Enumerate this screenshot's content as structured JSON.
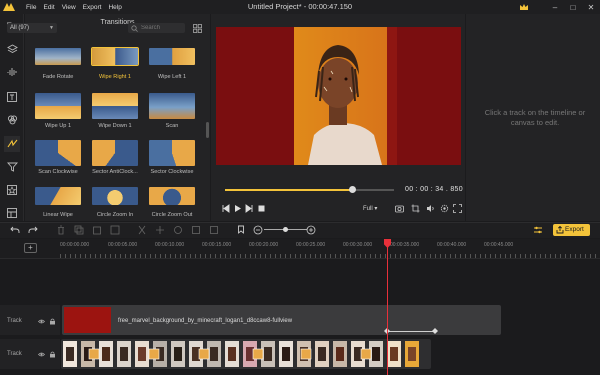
{
  "app": {
    "title": "Untitled Project* - 00:00:47.150",
    "menu": [
      "File",
      "Edit",
      "View",
      "Export",
      "Help"
    ]
  },
  "panel": {
    "title": "Transitions",
    "filter": "All (97)",
    "search_placeholder": "Search",
    "items": [
      {
        "label": "Fade Rotate"
      },
      {
        "label": "Wipe Right 1",
        "selected": true
      },
      {
        "label": "Wipe Left 1"
      },
      {
        "label": "Wipe Up 1"
      },
      {
        "label": "Wipe Down 1"
      },
      {
        "label": "Scan"
      },
      {
        "label": "Scan Clockwise"
      },
      {
        "label": "Sector AntiClock..."
      },
      {
        "label": "Sector Clockwise"
      },
      {
        "label": "Linear Wipe"
      },
      {
        "label": "Circle Zoom In"
      },
      {
        "label": "Circle Zoom Out"
      }
    ]
  },
  "preview": {
    "timecode": "00 : 00 : 34 . 850",
    "quality": "Full",
    "progress": 0.76
  },
  "properties": {
    "message": "Click a track on the timeline or canvas to edit."
  },
  "toolbar": {
    "export_label": "Export"
  },
  "ruler": {
    "ticks": [
      "00:00:00.000",
      "00:00:05.000",
      "00:00:10.000",
      "00:00:15.000",
      "00:00:20.000",
      "00:00:25.000",
      "00:00:30.000",
      "00:00:35.000",
      "00:00:40.000",
      "00:00:45.000"
    ]
  },
  "tracks": [
    {
      "label": "Track",
      "clip_name": "free_marvel_background_by_minecraft_logan1_d8ccaw8-fullview"
    },
    {
      "label": "Track"
    }
  ],
  "colors": {
    "accent": "#f3c33a",
    "playhead": "#e8303a",
    "background": "#1b1b1d"
  }
}
